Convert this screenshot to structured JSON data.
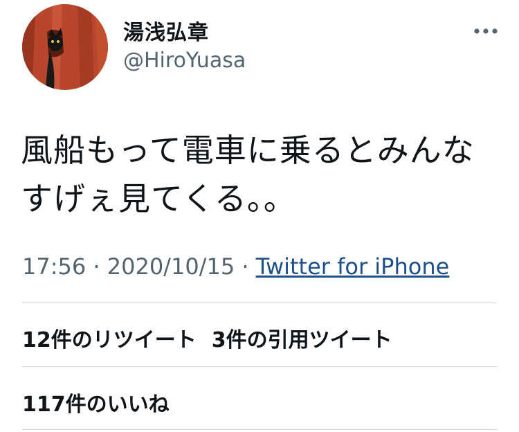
{
  "colors": {
    "text_primary": "#0f1419",
    "text_secondary": "#536471",
    "link": "#1d4f8c",
    "divider": "#cfd9de",
    "avatar_bg": "#b8462c"
  },
  "author": {
    "display_name": "湯浅弘章",
    "handle": "@HiroYuasa",
    "avatar_icon": "black-cat-avatar-icon"
  },
  "menu": {
    "icon": "more-horizontal-icon"
  },
  "tweet": {
    "lines": [
      "風船もって電車に乗るとみんな",
      "すげぇ見てくる。。"
    ]
  },
  "meta": {
    "time": "17:56",
    "separator": " · ",
    "date": "2020/10/15",
    "source": "Twitter for iPhone"
  },
  "stats": {
    "retweets_count": "12",
    "retweets_label": "件のリツイート",
    "quotes_count": "3",
    "quotes_label": "件の引用ツイート",
    "likes_count": "117",
    "likes_label": "件のいいね"
  }
}
